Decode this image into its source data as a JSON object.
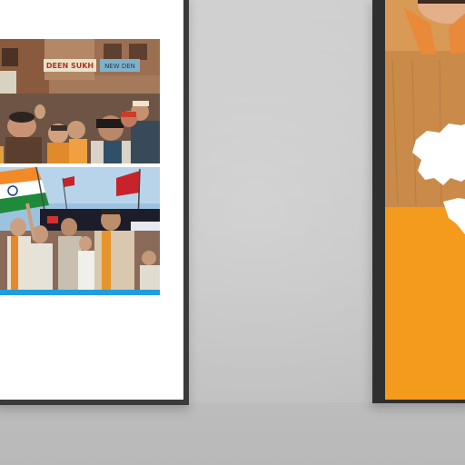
{
  "scene": {
    "wall_color": "#c8c8c8",
    "left_panel": {
      "photos": [
        {
          "name": "rally-photo-street",
          "signs": [
            "DEEN SUKH",
            "NEW DEN"
          ]
        },
        {
          "name": "rally-photo-flags",
          "signs": []
        }
      ],
      "accent_strip_color": "#1e9ee0"
    },
    "right_panel": {
      "poster_color": "#f39a1e",
      "suit_color": "#c98a4a"
    }
  }
}
